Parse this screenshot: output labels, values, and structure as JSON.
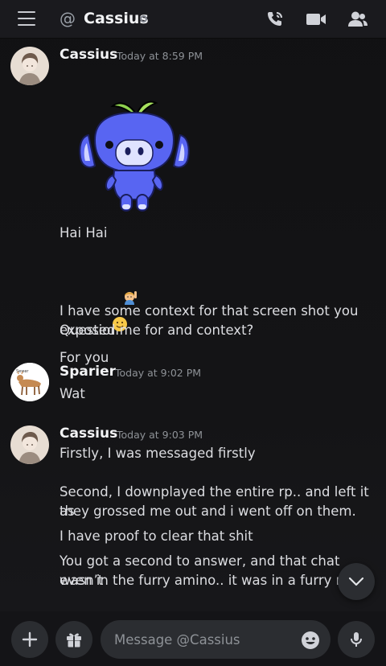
{
  "header": {
    "at_symbol": "@",
    "title": "Cassius",
    "icons": [
      "menu-icon",
      "phone-call-icon",
      "video-call-icon",
      "members-icon"
    ]
  },
  "messages": [
    {
      "author": "Cassius",
      "timestamp": "Today at 8:59 PM",
      "sticker": "wumpus-sticker",
      "lines": [
        "Hai Hai",
        "Question",
        "For you",
        "I have some context for that screen shot you",
        "exposed me for and context?"
      ],
      "emojis": {
        "question": "person-raising-hand-emoji",
        "for_you": "smiling-face-emoji"
      }
    },
    {
      "author": "Sparier",
      "timestamp": "Today at 9:02 PM",
      "avatar_label": "Sewer",
      "lines": [
        "Wat"
      ]
    },
    {
      "author": "Cassius",
      "timestamp": "Today at 9:03 PM",
      "lines": [
        "Firstly, I was messaged firstly",
        "Second, I downplayed the entire rp.. and left it as",
        "they grossed me out and i went off on them.",
        "I have proof to clear that shit",
        "You got a second to answer, and that chat wasn’t",
        "even in the furry amino.. it was in a furry rp s"
      ],
      "emojis": {
        "last": "unamused-face-emoji"
      }
    }
  ],
  "composer": {
    "placeholder": "Message @Cassius",
    "icons": [
      "plus-icon",
      "gift-icon",
      "emoji-icon",
      "microphone-icon"
    ]
  },
  "colors": {
    "background": "#121214",
    "header": "#1a1a1e",
    "input": "#2b2d31",
    "text": "#dcdde1",
    "muted": "#8e9297",
    "wumpus": "#5865f2"
  }
}
